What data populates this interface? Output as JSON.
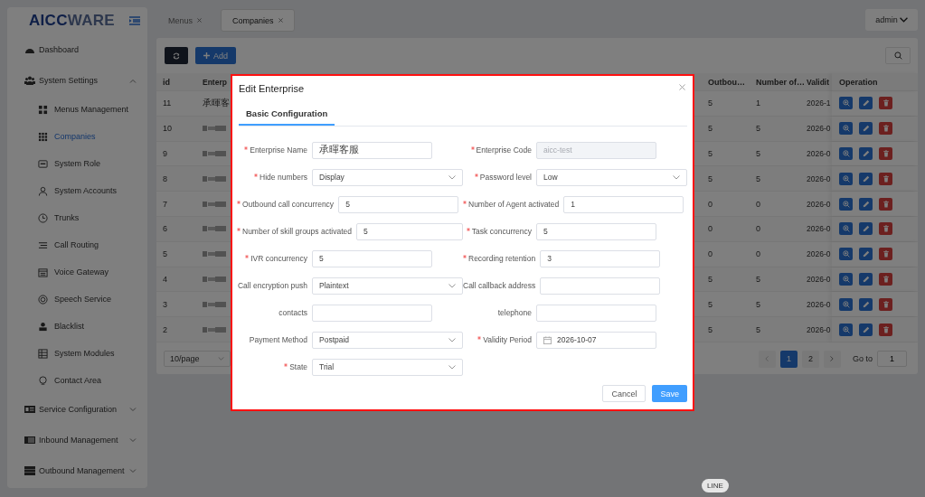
{
  "sidebar": {
    "logo": {
      "strong": "AICC",
      "light": "WARE"
    },
    "items": [
      {
        "label": "Dashboard",
        "kind": "link"
      },
      {
        "label": "System Settings",
        "kind": "group",
        "expanded": true,
        "children": [
          {
            "label": "Menus Management",
            "selected": false
          },
          {
            "label": "Companies",
            "selected": true
          },
          {
            "label": "System Role",
            "selected": false
          },
          {
            "label": "System Accounts",
            "selected": false
          },
          {
            "label": "Trunks",
            "selected": false
          },
          {
            "label": "Call Routing",
            "selected": false
          },
          {
            "label": "Voice Gateway",
            "selected": false
          },
          {
            "label": "Speech Service",
            "selected": false
          },
          {
            "label": "Blacklist",
            "selected": false
          },
          {
            "label": "System Modules",
            "selected": false
          },
          {
            "label": "Contact Area",
            "selected": false
          }
        ]
      },
      {
        "label": "Service Configuration",
        "kind": "group",
        "expanded": false
      },
      {
        "label": "Inbound Management",
        "kind": "group",
        "expanded": false
      },
      {
        "label": "Outbound Management",
        "kind": "group",
        "expanded": false
      }
    ]
  },
  "header": {
    "tabs": [
      {
        "label": "Menus",
        "selected": false
      },
      {
        "label": "Companies",
        "selected": true
      }
    ],
    "user": "admin"
  },
  "toolbar": {
    "add_button": "Add"
  },
  "table": {
    "columns": [
      "id",
      "Enterp",
      "Outbou…",
      "Number of…",
      "Validit",
      "Operation"
    ],
    "rows": [
      {
        "id": "11",
        "enterprise": "承暉客",
        "blurred": false,
        "outbound": "5",
        "agents": "1",
        "validity": "2026-1"
      },
      {
        "id": "10",
        "blurred": true,
        "outbound": "5",
        "agents": "5",
        "validity": "2026-0"
      },
      {
        "id": "9",
        "blurred": true,
        "outbound": "5",
        "agents": "5",
        "validity": "2026-0"
      },
      {
        "id": "8",
        "blurred": true,
        "outbound": "5",
        "agents": "5",
        "validity": "2026-0"
      },
      {
        "id": "7",
        "blurred": true,
        "outbound": "0",
        "agents": "0",
        "validity": "2026-0"
      },
      {
        "id": "6",
        "blurred": true,
        "outbound": "0",
        "agents": "0",
        "validity": "2026-0"
      },
      {
        "id": "5",
        "blurred": true,
        "outbound": "0",
        "agents": "0",
        "validity": "2026-0"
      },
      {
        "id": "4",
        "blurred": true,
        "outbound": "5",
        "agents": "5",
        "validity": "2026-0"
      },
      {
        "id": "3",
        "blurred": true,
        "outbound": "5",
        "agents": "5",
        "validity": "2026-0"
      },
      {
        "id": "2",
        "blurred": true,
        "outbound": "5",
        "agents": "5",
        "validity": "2026-0"
      }
    ]
  },
  "pagination": {
    "page_size": "10/page",
    "pages": [
      {
        "label": "1",
        "selected": true
      },
      {
        "label": "2",
        "selected": false
      }
    ],
    "goto_label": "Go to",
    "goto_value": "1"
  },
  "dialog": {
    "title": "Edit Enterprise",
    "tabs": [
      {
        "label": "Basic Configuration",
        "selected": true
      }
    ],
    "fields": [
      {
        "label": "Enterprise Name",
        "required": true,
        "kind": "input",
        "value": "承暉客服",
        "disabled": false
      },
      {
        "label": "Enterprise Code",
        "required": true,
        "kind": "input",
        "value": "aicc-test",
        "disabled": true
      },
      {
        "label": "Hide numbers",
        "required": true,
        "kind": "select",
        "value": "Display",
        "disabled": false
      },
      {
        "label": "Password level",
        "required": true,
        "kind": "select",
        "value": "Low",
        "disabled": false
      },
      {
        "label": "Outbound call concurrency",
        "required": true,
        "kind": "input",
        "value": "5",
        "disabled": false
      },
      {
        "label": "Number of Agent activated",
        "required": true,
        "kind": "input",
        "value": "1",
        "disabled": false
      },
      {
        "label": "Number of skill groups activated",
        "required": true,
        "kind": "input",
        "value": "5",
        "disabled": false
      },
      {
        "label": "Task concurrency",
        "required": true,
        "kind": "input",
        "value": "5",
        "disabled": false
      },
      {
        "label": "IVR concurrency",
        "required": true,
        "kind": "input",
        "value": "5",
        "disabled": false
      },
      {
        "label": "Recording retention",
        "required": true,
        "kind": "input",
        "value": "3",
        "disabled": false
      },
      {
        "label": "Call encryption push",
        "required": false,
        "kind": "select",
        "value": "Plaintext",
        "disabled": false
      },
      {
        "label": "Call callback address",
        "required": false,
        "kind": "input",
        "disabled": false
      },
      {
        "label": "contacts",
        "required": false,
        "kind": "input",
        "disabled": false
      },
      {
        "label": "telephone",
        "required": false,
        "kind": "input",
        "disabled": false
      },
      {
        "label": "Payment Method",
        "required": false,
        "kind": "select",
        "value": "Postpaid",
        "disabled": false
      },
      {
        "label": "Validity Period",
        "required": true,
        "kind": "date",
        "value": "2026-10-07",
        "disabled": false
      },
      {
        "label": "State",
        "required": true,
        "kind": "select",
        "value": "Trial",
        "disabled": false
      }
    ],
    "buttons": {
      "cancel": "Cancel",
      "save": "Save"
    }
  },
  "tooltip": "LINE"
}
